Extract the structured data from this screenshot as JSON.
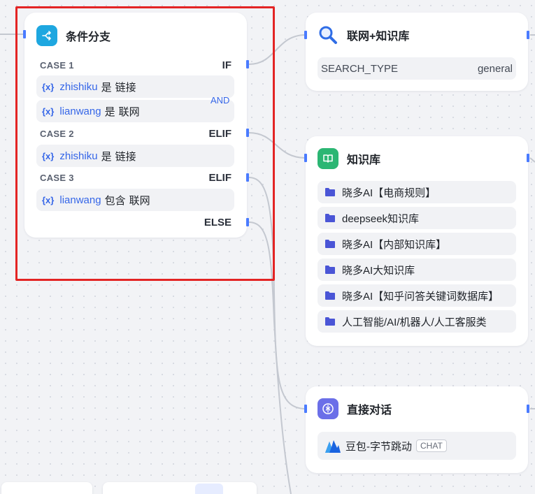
{
  "condition_node": {
    "title": "条件分支",
    "icon": "branch-icon",
    "cases": [
      {
        "label": "CASE 1",
        "keyword": "IF"
      },
      {
        "label": "CASE 2",
        "keyword": "ELIF"
      },
      {
        "label": "CASE 3",
        "keyword": "ELIF"
      }
    ],
    "conditions": [
      {
        "var_icon": "{x}",
        "var": "zhishiku",
        "op": "是",
        "value": "链接"
      },
      {
        "var_icon": "{x}",
        "var": "lianwang",
        "op": "是",
        "value": "联网"
      },
      {
        "var_icon": "{x}",
        "var": "zhishiku",
        "op": "是",
        "value": "链接"
      },
      {
        "var_icon": "{x}",
        "var": "lianwang",
        "op": "包含",
        "value": "联网"
      }
    ],
    "and_label": "AND",
    "else_label": "ELSE"
  },
  "search_node": {
    "title": "联网+知识库",
    "icon": "search-icon",
    "param_key": "SEARCH_TYPE",
    "param_value": "general"
  },
  "kb_node": {
    "title": "知识库",
    "icon": "book-icon",
    "items": [
      "晓多AI【电商规则】",
      "deepseek知识库",
      "晓多AI【内部知识库】",
      "晓多AI大知识库",
      "晓多AI【知乎问答关键词数据库】",
      "人工智能/AI/机器人/人工客服类"
    ]
  },
  "chat_node": {
    "title": "直接对话",
    "icon": "chat-icon",
    "model": "豆包-字节跳动",
    "model_tag": "CHAT"
  },
  "colors": {
    "accent": "#3566e8",
    "handle": "#4a7bff",
    "highlight": "#e32424",
    "condition_icon_bg": "#1ea7e0",
    "kb_icon_bg": "#2bb673",
    "chat_icon_bg": "#6b6fe8"
  }
}
